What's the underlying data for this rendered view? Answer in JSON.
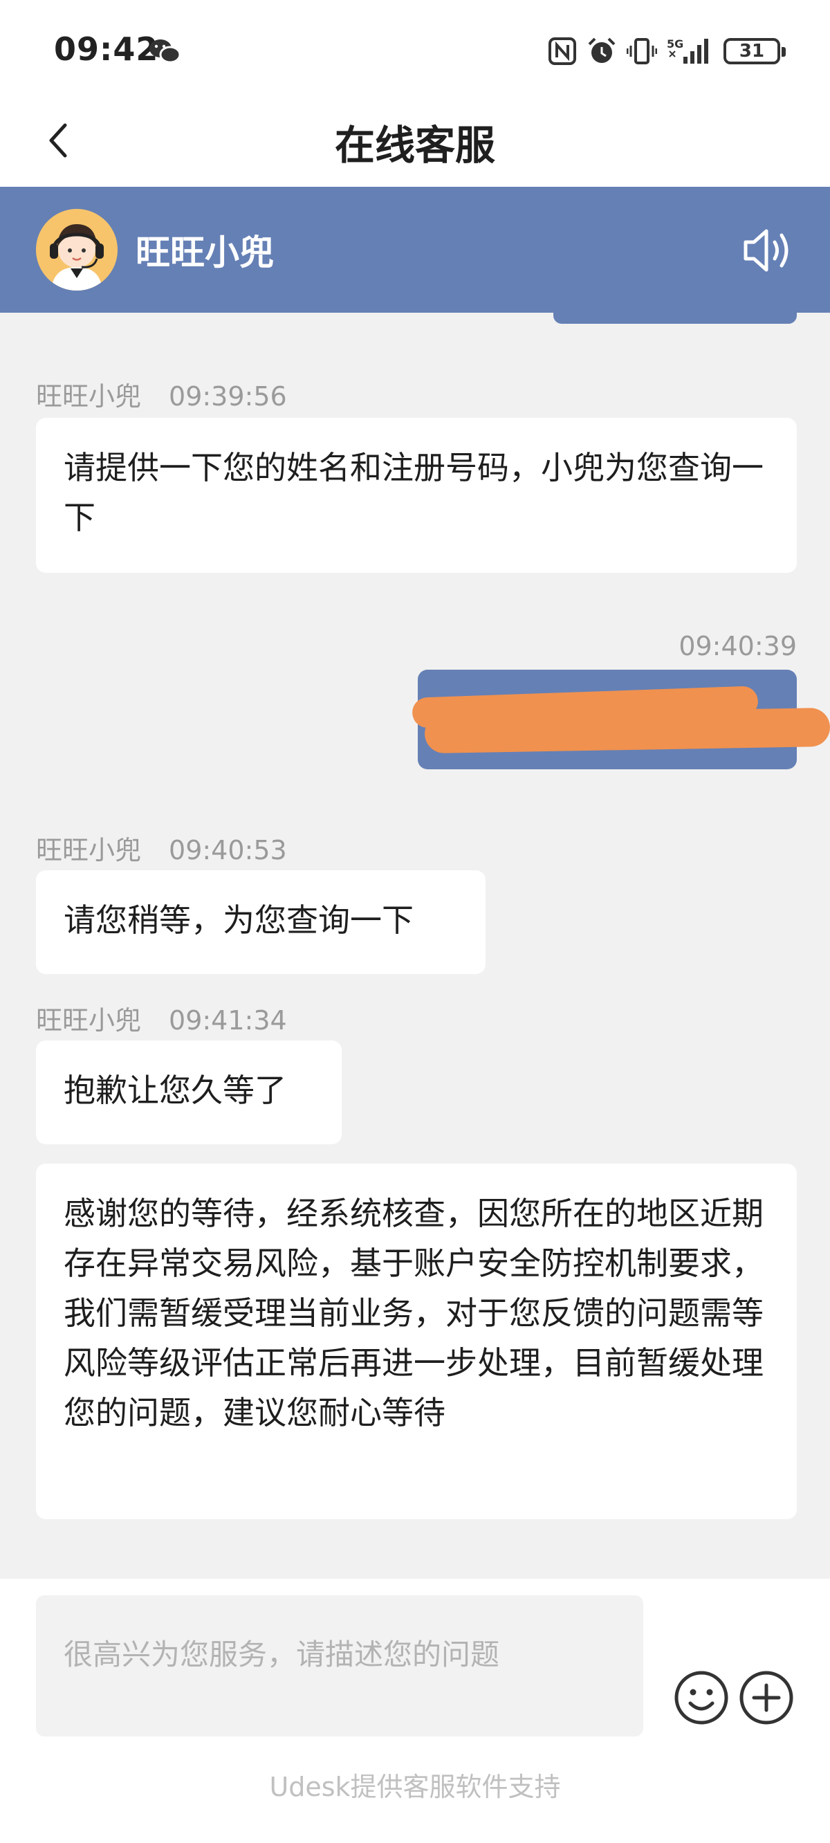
{
  "status_bar": {
    "time": "09:42",
    "network": "5G",
    "battery": "31",
    "icons": [
      "wechat-icon",
      "nfc-icon",
      "alarm-icon",
      "vibrate-icon",
      "signal-icon",
      "battery-icon"
    ]
  },
  "nav": {
    "title": "在线客服",
    "back_icon": "chevron-left-icon"
  },
  "agent": {
    "name": "旺旺小兜",
    "speaker_icon": "speaker-icon"
  },
  "messages": [
    {
      "sender": "旺旺小兜",
      "time": "09:39:56",
      "text": "请提供一下您的姓名和注册号码，小兜为您查询一下"
    },
    {
      "sender": "user",
      "time": "09:40:39",
      "text": ""
    },
    {
      "sender": "旺旺小兜",
      "time": "09:40:53",
      "text": "请您稍等，为您查询一下"
    },
    {
      "sender": "旺旺小兜",
      "time": "09:41:34",
      "text": "抱歉让您久等了"
    },
    {
      "sender": "旺旺小兜",
      "time": "",
      "text": "感谢您的等待，经系统核查，因您所在的地区近期存在异常交易风险，基于账户安全防控机制要求，我们需暂缓受理当前业务，对于您反馈的问题需等风险等级评估正常后再进一步处理，目前暂缓处理您的问题，建议您耐心等待"
    }
  ],
  "input": {
    "placeholder": "很高兴为您服务，请描述您的问题",
    "value": ""
  },
  "footer": "Udesk提供客服软件支持",
  "colors": {
    "header": "#6580b5",
    "user_bubble": "#6580b5",
    "redaction": "#f0914f",
    "chat_bg": "#f1f1f1"
  }
}
